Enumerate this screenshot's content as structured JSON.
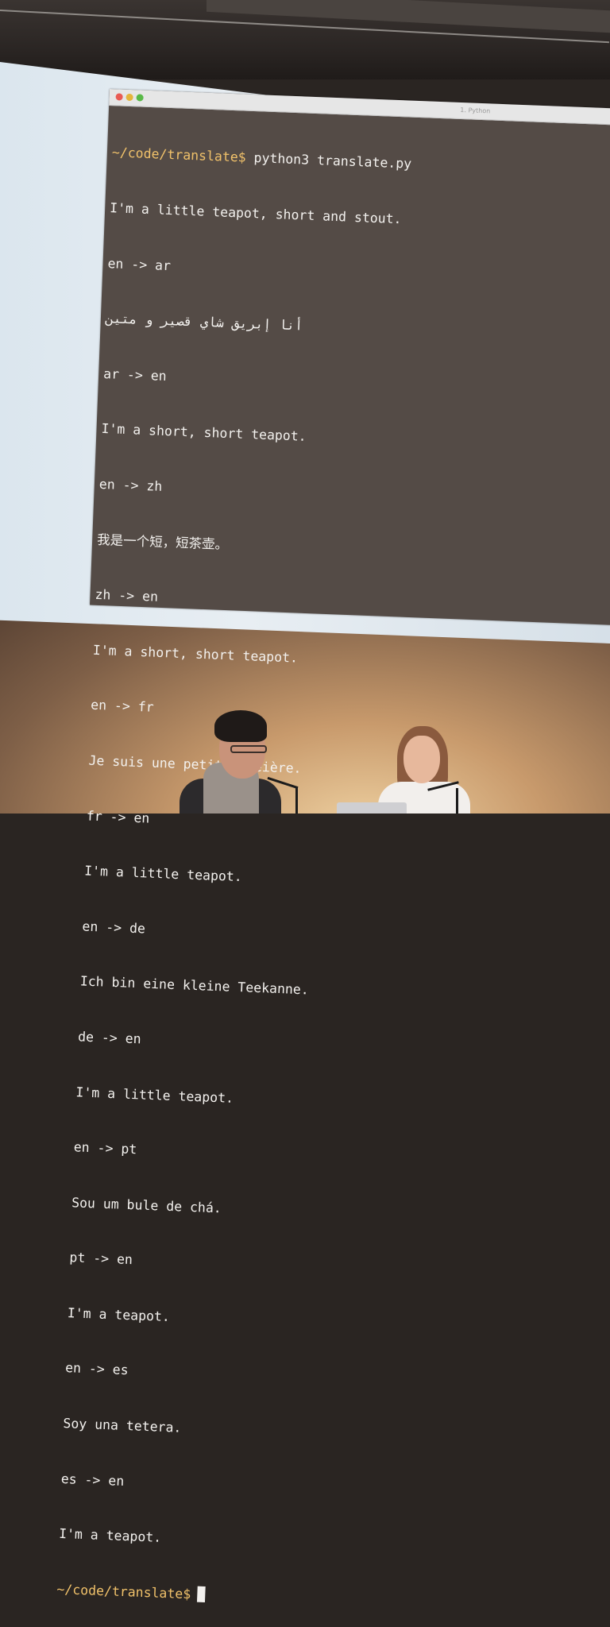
{
  "terminal": {
    "tab_title": "1. Python",
    "prompt_path": "~/code/translate$",
    "command": " python3 translate.py",
    "lines": [
      "I'm a little teapot, short and stout.",
      "en -> ar",
      "أنا إبريق شاي قصير و متين",
      "ar -> en",
      "I'm a short, short teapot.",
      "en -> zh",
      "我是一个短，短茶壶。",
      "zh -> en",
      "I'm a short, short teapot.",
      "en -> fr",
      "Je suis une petite théière.",
      "fr -> en",
      "I'm a little teapot.",
      "en -> de",
      "Ich bin eine kleine Teekanne.",
      "de -> en",
      "I'm a little teapot.",
      "en -> pt",
      "Sou um bule de chá.",
      "pt -> en",
      "I'm a teapot.",
      "en -> es",
      "Soy una tetera.",
      "es -> en",
      "I'm a teapot."
    ],
    "final_prompt": "~/code/translate$"
  }
}
